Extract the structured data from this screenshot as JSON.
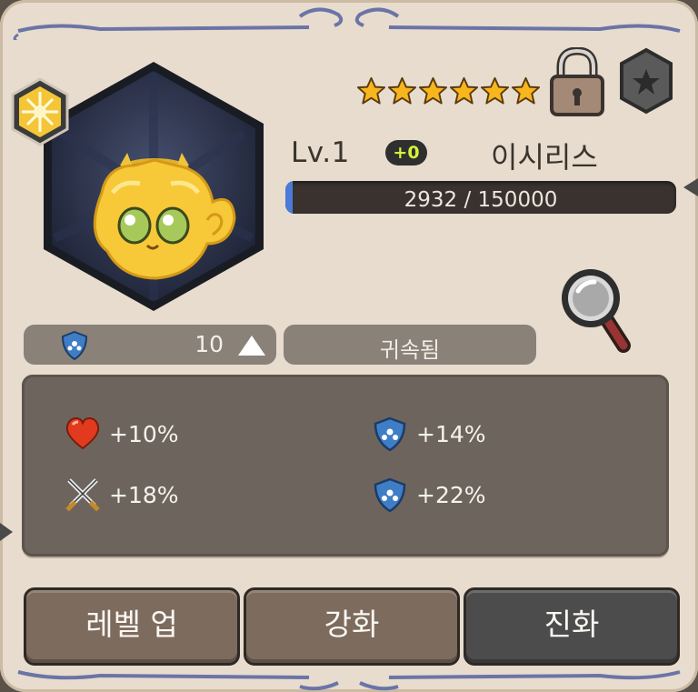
{
  "character": {
    "level_label": "Lv.1",
    "plus_badge": "+0",
    "name": "이시리스",
    "stars": 6,
    "element_icon": "sun-burst-icon"
  },
  "exp": {
    "text": "2932 / 150000",
    "progress_fraction": 0.0195
  },
  "strip": {
    "count": "10",
    "bound_label": "귀속됨"
  },
  "bonuses": [
    {
      "icon": "heart-icon",
      "value": "+10%"
    },
    {
      "icon": "shield-icon",
      "value": "+14%"
    },
    {
      "icon": "crossed-swords-icon",
      "value": "+18%"
    },
    {
      "icon": "shield-icon",
      "value": "+22%"
    }
  ],
  "buttons": {
    "level_up": "레벨 업",
    "enhance": "강화",
    "evolve": "진화"
  },
  "colors": {
    "panel_bg": "#e7dccd",
    "exp_fill": "#4a7bd8",
    "badge_text": "#d5f23a",
    "star": "#f7b61c"
  }
}
